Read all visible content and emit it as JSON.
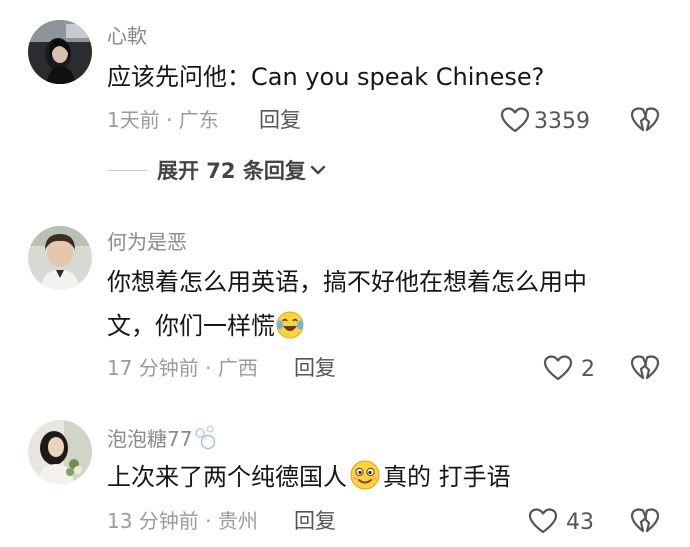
{
  "comments": [
    {
      "username": "心軟",
      "text": "应该先问他：Can you speak Chinese?",
      "meta": "1天前 · 广东",
      "reply_label": "回复",
      "likes": "3359",
      "expand_label": "展开 72 条回复",
      "avatar_icon": "avatar-woman-in-car"
    },
    {
      "username": "何为是恶",
      "text_line1": "你想着怎么用英语，搞不好他在想着怎么用中",
      "text_line2": "文，你们一样慌",
      "emoji": "crying-laughing-emoji",
      "meta": "17 分钟前 · 广西",
      "reply_label": "回复",
      "likes": "2",
      "avatar_icon": "avatar-young-man"
    },
    {
      "username": "泡泡糖77",
      "username_icon": "bubbles-icon",
      "text_part1": "上次来了两个纯德国人",
      "text_part2": "真的 打手语",
      "emoji": "cheeky-smile-emoji",
      "meta": "13 分钟前 · 贵州",
      "reply_label": "回复",
      "likes": "43",
      "avatar_icon": "avatar-woman-with-flowers"
    }
  ],
  "colors": {
    "username": "#8a8a8a",
    "text": "#161616",
    "meta": "#9b9b9b",
    "icon": "#555555"
  }
}
